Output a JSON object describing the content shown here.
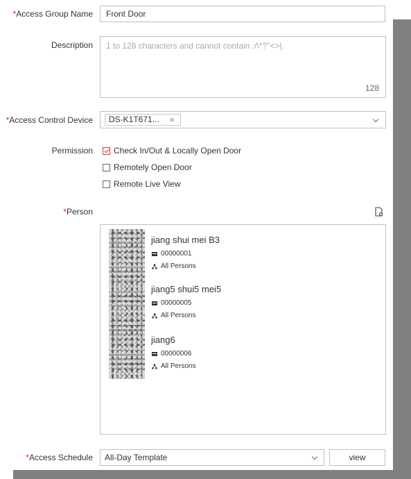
{
  "form": {
    "access_group_name": {
      "label": "Access Group Name",
      "required_mark": "*",
      "value": "Front Door"
    },
    "description": {
      "label": "Description",
      "placeholder": "1 to 128 characters and cannot contain :/\\*?\"<>|.",
      "counter": "128"
    },
    "access_control_device": {
      "label": "Access Control Device",
      "required_mark": "*",
      "selected_tag": "DS-K1T671...",
      "remove_glyph": "×"
    },
    "permission": {
      "label": "Permission",
      "options": [
        {
          "label": "Check In/Out & Locally Open Door",
          "checked": true
        },
        {
          "label": "Remotely Open Door",
          "checked": false
        },
        {
          "label": "Remote Live View",
          "checked": false
        }
      ]
    },
    "person": {
      "label": "Person",
      "required_mark": "*",
      "items": [
        {
          "name": "jiang shui mei B3",
          "id": "00000001",
          "org": "All Persons"
        },
        {
          "name": "jiang5 shui5 mei5",
          "id": "00000005",
          "org": "All Persons"
        },
        {
          "name": "jiang6",
          "id": "00000006",
          "org": "All Persons"
        }
      ]
    },
    "access_schedule": {
      "label": "Access Schedule",
      "required_mark": "*",
      "value": "All-Day Template",
      "view_button": "view"
    }
  },
  "icons": {
    "device_dropdown": "chevron-down-icon",
    "person_import": "document-icon",
    "card": "card-icon",
    "org": "org-icon"
  },
  "colors": {
    "required": "#e02020",
    "check": "#d9362b",
    "border": "#bfbfbf",
    "shadow": "#808080"
  }
}
